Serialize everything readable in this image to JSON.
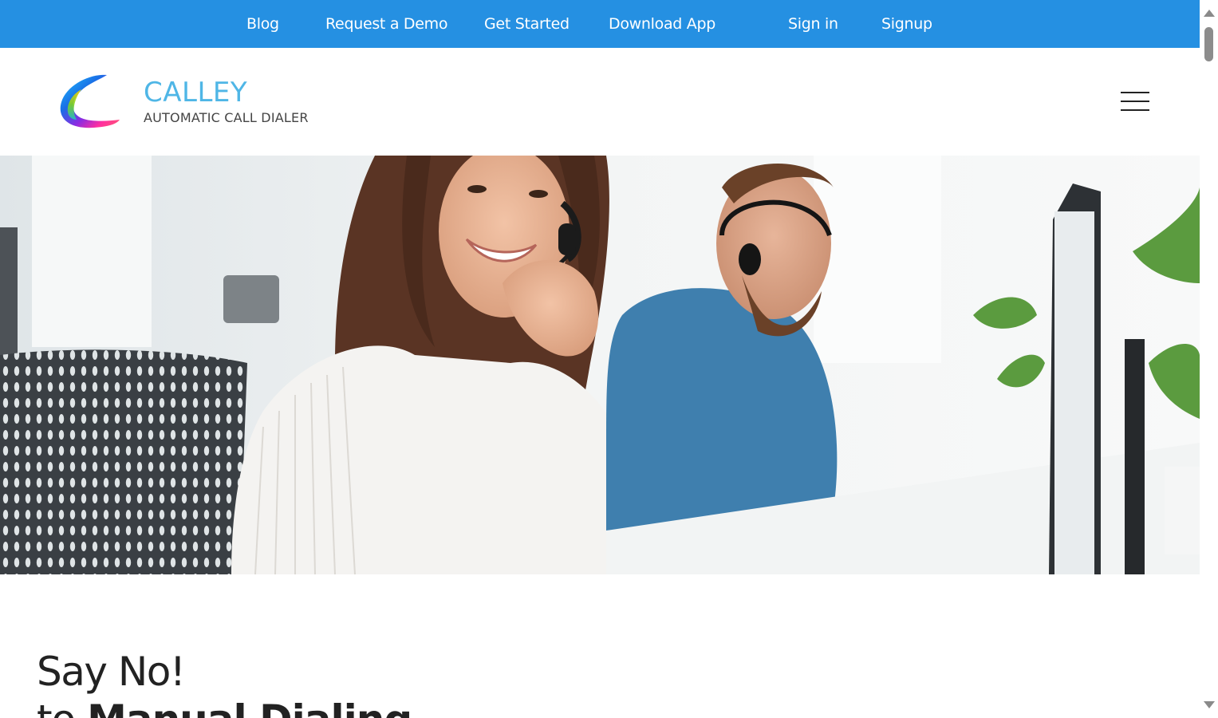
{
  "nav": {
    "blog": "Blog",
    "request_demo": "Request a Demo",
    "get_started": "Get Started",
    "download_app": "Download App",
    "sign_in": "Sign in",
    "signup": "Signup"
  },
  "brand": {
    "name": "CALLEY",
    "tagline": "AUTOMATIC CALL DIALER",
    "nav_color": "#2590e2",
    "logo_text_color": "#4fb6e6"
  },
  "header": {
    "menu_icon": "hamburger-menu-icon"
  },
  "hero": {
    "image": "call-center-agents-with-headsets-photo"
  },
  "headline": {
    "line1": "Say No!",
    "line2_prefix": "to ",
    "line2_bold": "Manual Dialing"
  }
}
